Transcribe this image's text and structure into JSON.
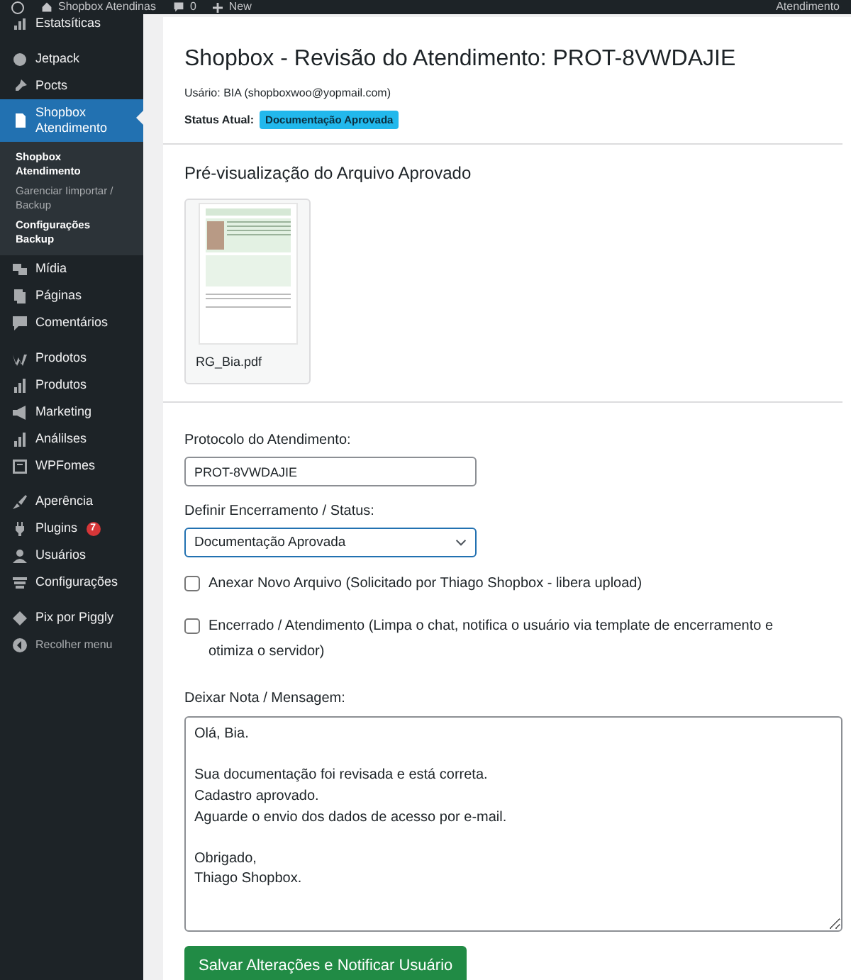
{
  "admin_bar": {
    "site": "Shopbox Atendinas",
    "comments": "0",
    "new": "New",
    "account": "Atendimento"
  },
  "sidebar": {
    "items": [
      {
        "label": "Estatsíticas",
        "kind": "chart",
        "selected": false
      },
      {
        "label": "Jetpack",
        "kind": "jetpack",
        "selected": false
      },
      {
        "label": "Pocts",
        "kind": "pin",
        "selected": false
      },
      {
        "label": "Shopbox Atendimento",
        "kind": "document",
        "selected": true,
        "children": [
          {
            "label": "Shopbox Atendimento",
            "selected": true
          },
          {
            "label": "Garenciar Iimportar / Backup",
            "selected": false
          },
          {
            "label": "Configurações Backup",
            "selected": true
          }
        ]
      },
      {
        "label": "Mídia",
        "kind": "media",
        "selected": false
      },
      {
        "label": "Páginas",
        "kind": "pages",
        "selected": false
      },
      {
        "label": "Comentários",
        "kind": "comment",
        "selected": false
      },
      {
        "label": "Prodotos",
        "kind": "woo",
        "selected": false
      },
      {
        "label": "Produtos",
        "kind": "bars",
        "selected": false
      },
      {
        "label": "Marketing",
        "kind": "megaphone",
        "selected": false
      },
      {
        "label": "Análilses",
        "kind": "bars",
        "selected": false
      },
      {
        "label": "WPFomes",
        "kind": "form",
        "selected": false
      },
      {
        "label": "Aperência",
        "kind": "brush",
        "selected": false
      },
      {
        "label": "Plugins",
        "kind": "plug",
        "selected": false,
        "badge": "7"
      },
      {
        "label": "Usuários",
        "kind": "user",
        "selected": false
      },
      {
        "label": "Configurações",
        "kind": "settings",
        "selected": false
      },
      {
        "label": "Pix por Piggly",
        "kind": "diamond",
        "selected": false
      },
      {
        "label": "Recolher menu",
        "kind": "collapse",
        "selected": false
      }
    ]
  },
  "page": {
    "title": "Shopbox - Revisão do Atendimento: PROT-8VWDAJIE",
    "user_line": "Usário: BIA (shopboxwoo@yopmail.com)",
    "status_label": "Status Atual:",
    "status_badge": "Documentação Aprovada",
    "preview_heading": "Pré-visualização do Arquivo Aprovado",
    "file": {
      "name": "RG_Bia.pdf"
    },
    "protocol": {
      "label": "Protocolo do Atendimento:",
      "value": "PROT-8VWDAJIE"
    },
    "status_select": {
      "label": "Definir Encerramento / Status:",
      "value": "Documentação Aprovada"
    },
    "options": [
      {
        "label": "Anexar Novo Arquivo (Solicitado por Thiago Shopbox - libera upload)",
        "checked": false
      },
      {
        "label": "Encerrado / Atendimento (Limpa o chat, notifica o usuário via template de encerramento e otimiza o servidor)",
        "checked": false
      }
    ],
    "note": {
      "label": "Deixar Nota / Mensagem:",
      "value": "Olá, Bia.\n\nSua documentação foi revisada e está correta.\nCadastro aprovado.\nAguarde o envio dos dados de acesso por e-mail.\n\nObrigado,\nThiago Shopbox."
    },
    "submit": "Salvar Alterações e Notificar Usuário"
  }
}
